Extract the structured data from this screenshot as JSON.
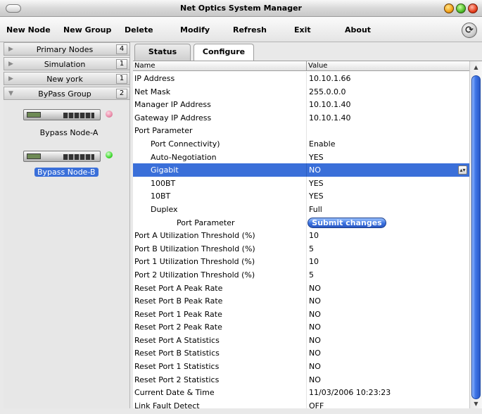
{
  "window": {
    "title": "Net Optics System Manager"
  },
  "menu": {
    "new_node": "New Node",
    "new_group": "New Group",
    "delete": "Delete",
    "modify": "Modify",
    "refresh": "Refresh",
    "exit": "Exit",
    "about": "About"
  },
  "sidebar": {
    "groups": [
      {
        "label": "Primary Nodes",
        "count": "4"
      },
      {
        "label": "Simulation",
        "count": "1"
      },
      {
        "label": "New york",
        "count": "1"
      },
      {
        "label": "ByPass Group",
        "count": "2"
      }
    ],
    "nodes": [
      {
        "label": "Bypass Node-A",
        "status_color": "#e98aa8"
      },
      {
        "label": "Bypass Node-B",
        "status_color": "#3fd92e"
      }
    ]
  },
  "tabs": {
    "status": "Status",
    "configure": "Configure"
  },
  "table": {
    "headers": {
      "name": "Name",
      "value": "Value"
    },
    "rows": [
      {
        "name": "IP Address",
        "value": "10.10.1.66"
      },
      {
        "name": "Net Mask",
        "value": "255.0.0.0"
      },
      {
        "name": "Manager IP Address",
        "value": "10.10.1.40"
      },
      {
        "name": "Gateway IP Address",
        "value": "10.10.1.40"
      },
      {
        "name": "Port Parameter",
        "value": ""
      },
      {
        "name": "Port Connectivity)",
        "value": "Enable"
      },
      {
        "name": "Auto-Negotiation",
        "value": "YES"
      },
      {
        "name": "Gigabit",
        "value": "NO"
      },
      {
        "name": "100BT",
        "value": "YES"
      },
      {
        "name": "10BT",
        "value": "YES"
      },
      {
        "name": "Duplex",
        "value": "Full"
      },
      {
        "name": "Port Parameter",
        "value": ""
      },
      {
        "name": "Port A Utilization Threshold (%)",
        "value": "10"
      },
      {
        "name": "Port B Utilization Threshold (%)",
        "value": "5"
      },
      {
        "name": "Port 1 Utilization Threshold (%)",
        "value": "10"
      },
      {
        "name": "Port 2 Utilization Threshold (%)",
        "value": "5"
      },
      {
        "name": "Reset Port A Peak Rate",
        "value": "NO"
      },
      {
        "name": "Reset Port B Peak Rate",
        "value": "NO"
      },
      {
        "name": "Reset Port 1 Peak Rate",
        "value": "NO"
      },
      {
        "name": "Reset Port 2 Peak Rate",
        "value": "NO"
      },
      {
        "name": "Reset Port A Statistics",
        "value": "NO"
      },
      {
        "name": "Reset Port B Statistics",
        "value": "NO"
      },
      {
        "name": "Reset Port 1 Statistics",
        "value": "NO"
      },
      {
        "name": "Reset Port 2 Statistics",
        "value": "NO"
      },
      {
        "name": "Current Date & Time",
        "value": "11/03/2006 10:23:23"
      },
      {
        "name": "Link Fault Detect",
        "value": "OFF"
      }
    ],
    "submit_label": "Submit changes"
  },
  "colors": {
    "selection": "#3a6fd9",
    "accent": "#2a58c2"
  }
}
